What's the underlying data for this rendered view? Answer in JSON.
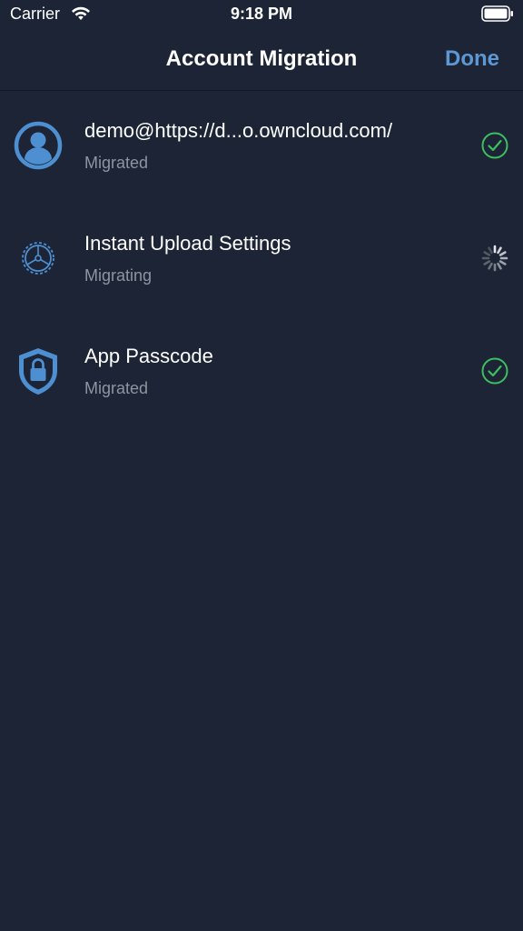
{
  "status_bar": {
    "carrier": "Carrier",
    "time": "9:18 PM"
  },
  "nav": {
    "title": "Account Migration",
    "done_label": "Done"
  },
  "items": [
    {
      "title": "demo@https://d...o.owncloud.com/",
      "status": "Migrated",
      "icon": "account-icon",
      "state": "done"
    },
    {
      "title": "Instant Upload Settings",
      "status": "Migrating",
      "icon": "settings-gear-icon",
      "state": "in-progress"
    },
    {
      "title": "App Passcode",
      "status": "Migrated",
      "icon": "shield-lock-icon",
      "state": "done"
    }
  ],
  "colors": {
    "background": "#1c2435",
    "accent": "#5e98d4",
    "success": "#3ebd61",
    "secondary_text": "#8e95a1"
  }
}
